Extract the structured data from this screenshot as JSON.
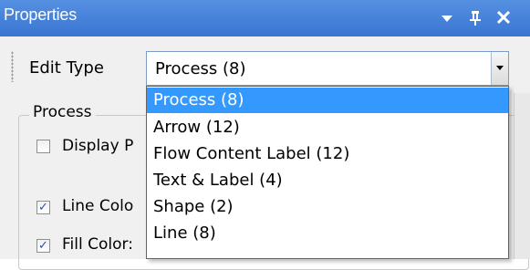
{
  "window": {
    "title": "Properties",
    "controls": {
      "dropdown_glyph": "▾",
      "pin_glyph": "ф",
      "close_glyph": "✕"
    }
  },
  "toolbar": {
    "edit_type_label": "Edit Type",
    "combo_value": "Process (8)"
  },
  "group": {
    "legend": "Process",
    "checkboxes": [
      {
        "label": "Display P",
        "checked": false
      },
      {
        "label": "Line Colo",
        "checked": true
      },
      {
        "label": "Fill Color:",
        "checked": true
      }
    ]
  },
  "dropdown": {
    "selected_index": 0,
    "options": [
      "Process (8)",
      "Arrow (12)",
      "Flow Content Label (12)",
      "Text & Label (4)",
      "Shape (2)",
      "Line (8)"
    ]
  },
  "colors": {
    "title_bar": "#3a75d2",
    "selection": "#3399ff"
  }
}
